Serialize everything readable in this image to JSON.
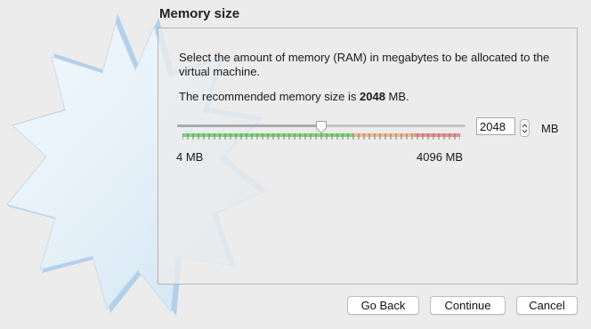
{
  "page": {
    "title": "Memory size",
    "description": "Select the amount of memory (RAM) in megabytes to be allocated to the virtual machine.",
    "recommended_prefix": "The recommended memory size is ",
    "recommended_value": "2048",
    "recommended_suffix": " MB."
  },
  "memory": {
    "value": "2048",
    "unit": "MB",
    "min_label": "4 MB",
    "max_label": "4096 MB",
    "min": 4,
    "max": 4096,
    "current": 2048
  },
  "colors": {
    "tick_green": "#7fd67a",
    "tick_orange": "#f3b796",
    "tick_red": "#ef8f93",
    "wizard_star": "#dcecf8"
  },
  "buttons": {
    "back": "Go Back",
    "continue": "Continue",
    "cancel": "Cancel"
  }
}
